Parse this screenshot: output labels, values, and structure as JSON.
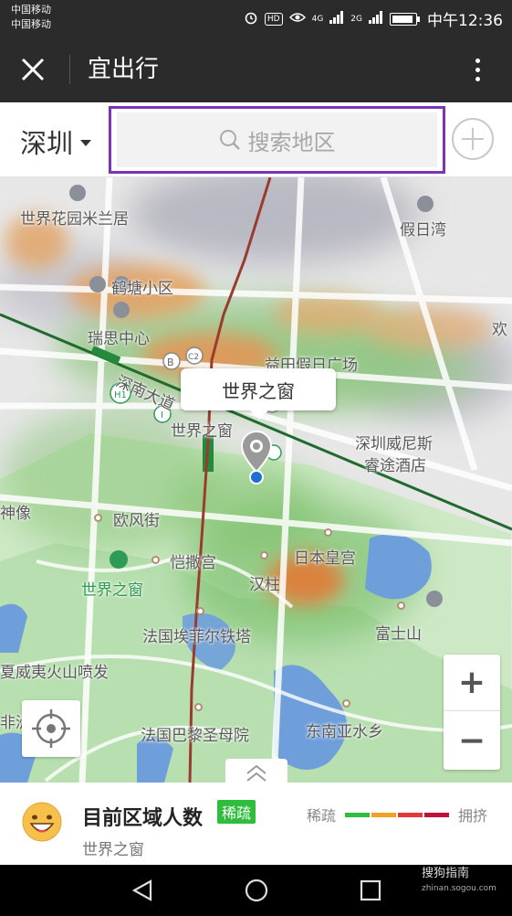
{
  "status_bar": {
    "carrier_1": "中国移动",
    "carrier_2": "中国移动",
    "hd_badge": "HD",
    "net_1": "4G",
    "net_2": "2G",
    "time": "中午12:36",
    "icons": [
      "alarm-icon",
      "eye-icon",
      "signal-icon",
      "battery-icon"
    ]
  },
  "header": {
    "title": "宜出行",
    "close_icon": "close-icon",
    "more_icon": "more-vertical-icon"
  },
  "search": {
    "city": "深圳",
    "placeholder": "搜索地区",
    "highlight_color": "#7c33b6"
  },
  "map": {
    "labels": [
      {
        "text": "世界花园米兰居"
      },
      {
        "text": "假日湾"
      },
      {
        "text": "鹤塘小区"
      },
      {
        "text": "瑞思中心"
      },
      {
        "text": "欢"
      },
      {
        "text": "益田假日广场"
      },
      {
        "text": "深南大道"
      },
      {
        "text": "世界之窗"
      },
      {
        "text": "深圳威尼斯"
      },
      {
        "text": "睿途酒店"
      },
      {
        "text": "神像"
      },
      {
        "text": "欧风街"
      },
      {
        "text": "恺撒宫"
      },
      {
        "text": "日本皇宫"
      },
      {
        "text": "世界之窗"
      },
      {
        "text": "汉柱"
      },
      {
        "text": "富士山"
      },
      {
        "text": "法国埃菲尔铁塔"
      },
      {
        "text": "夏威夷火山喷发"
      },
      {
        "text": "非洲"
      },
      {
        "text": "东南亚水乡"
      },
      {
        "text": "法国巴黎圣母院"
      }
    ],
    "callout": "世界之窗",
    "zoom_in": "+",
    "zoom_out": "−"
  },
  "panel": {
    "title": "目前区域人数",
    "badge": "稀疏",
    "location": "世界之窗",
    "legend_low": "稀疏",
    "legend_high": "拥挤",
    "legend_colors": [
      "#2fbd3e",
      "#f0a023",
      "#e23a3a",
      "#c2103c"
    ]
  },
  "watermark": {
    "brand": "搜狗指南",
    "url": "zhinan.sogou.com"
  }
}
